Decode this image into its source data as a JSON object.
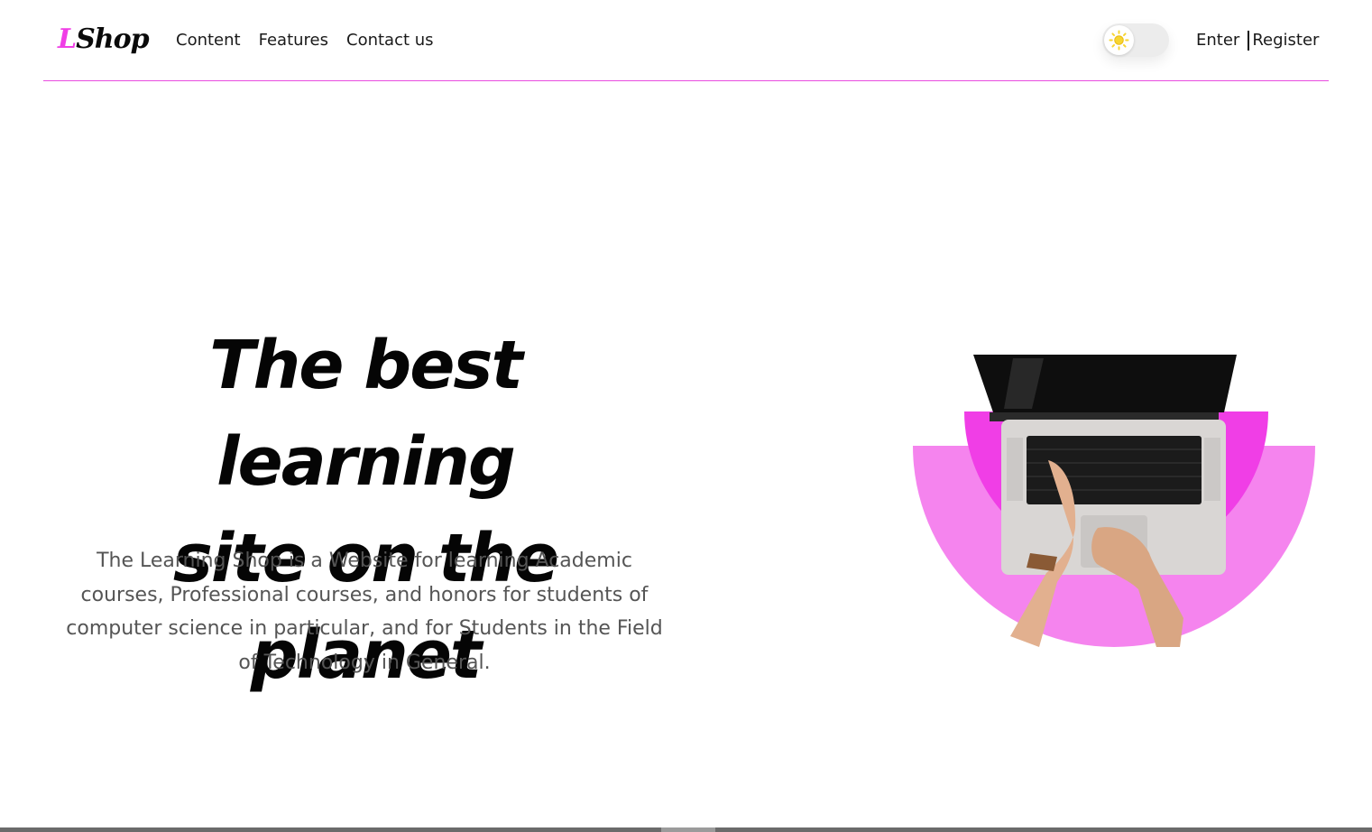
{
  "header": {
    "logo": {
      "first_letter": "L",
      "rest": "Shop"
    },
    "nav": [
      "Content",
      "Features",
      "Contact us"
    ],
    "theme_toggle": {
      "mode": "light",
      "icon": "sun-icon"
    },
    "auth": {
      "enter": "Enter",
      "register": "Register"
    }
  },
  "hero": {
    "title_line1": "The best learning",
    "title_line2": "site on the planet",
    "description": "The Learning Shop is a Website for learning Academic courses, Professional courses, and honors for students of computer science in particular, and for Students in the Field of Technology in General.",
    "image": "laptop-hands-illustration"
  },
  "colors": {
    "accent": "#f03ee6",
    "accent_light": "#f584ee",
    "divider": "#e94ce0",
    "text_dark": "#0a0a0a",
    "text_muted": "#555555"
  }
}
